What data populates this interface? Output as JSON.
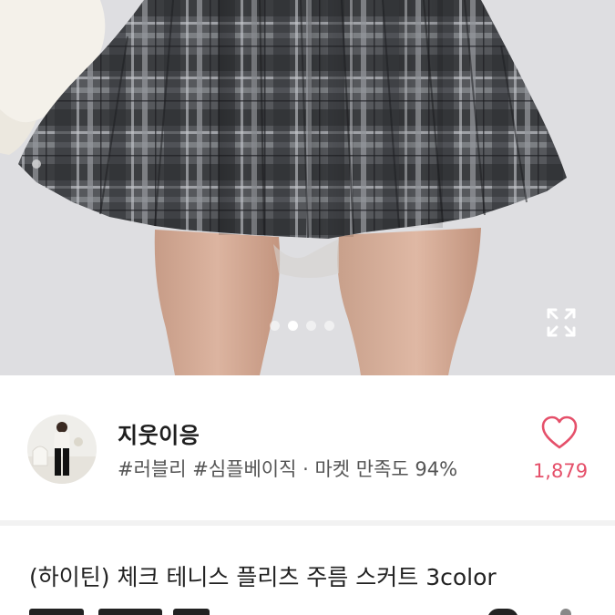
{
  "carousel": {
    "total": 4,
    "active_index": 1
  },
  "icons": {
    "expand": "expand-icon",
    "like": "heart-outline-icon"
  },
  "seller": {
    "name": "지웃이응",
    "meta": "#러블리 #심플베이직 · 마켓 만족도 94%",
    "likes": "1,879"
  },
  "product": {
    "title": "(하이틴) 체크 테니스 플리츠 주름 스커트 3color"
  },
  "colors": {
    "like_accent": "#e5506a",
    "text_primary": "#1e1e1e",
    "text_secondary": "#555555"
  }
}
